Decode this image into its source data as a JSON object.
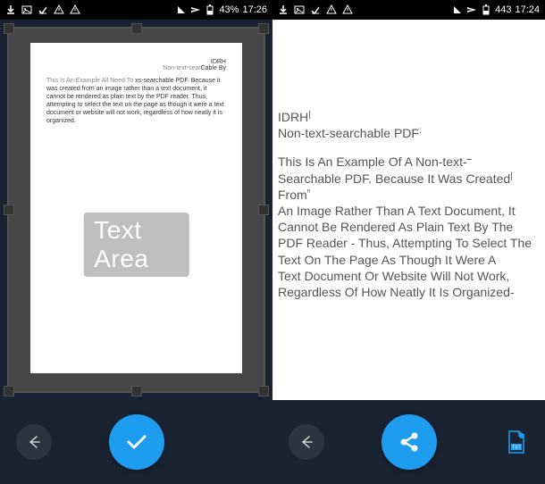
{
  "left": {
    "status": {
      "battery": "43%",
      "time": "17:26"
    },
    "page": {
      "header_line1": "IDRH",
      "header_line2_dim": "Non-text-sear",
      "header_line2_rest": "Cable By",
      "body_dim": "This Is An Example All Need To",
      "body_rest": "xs-searchable PDF. Because it was created from an image rather than a text document, it cannot be rendered as plain text by the PDF reader. Thus, attempting to select the text on the page as though it were a text document or website will not work, regardless of how neatly it is organized.",
      "overlay": "Text Area"
    }
  },
  "right": {
    "status": {
      "battery": "443",
      "time": "17:24"
    },
    "text": {
      "hdr1": "IDRH",
      "hdr2": "Non-text-searchable PDF",
      "l1": "This Is An Example Of A Non-text-",
      "l2": "Searchable PDF. Because It Was Created",
      "l3": "From",
      "l4": "An Image Rather Than A Text Document, It",
      "l5": "Cannot Be Rendered As Plain Text By The",
      "l6": "PDF Reader - Thus, Attempting To Select The",
      "l7": "Text On The Page As Though It Were A",
      "l8": "Text Document Or Website Will Not Work,",
      "l9": "Regardless Of How Neatly It Is Organized-"
    }
  },
  "icons": {
    "download": "↓",
    "image": "▣",
    "check": "✓",
    "warning": "⚠",
    "signal": "◢",
    "airplane": "✈"
  }
}
